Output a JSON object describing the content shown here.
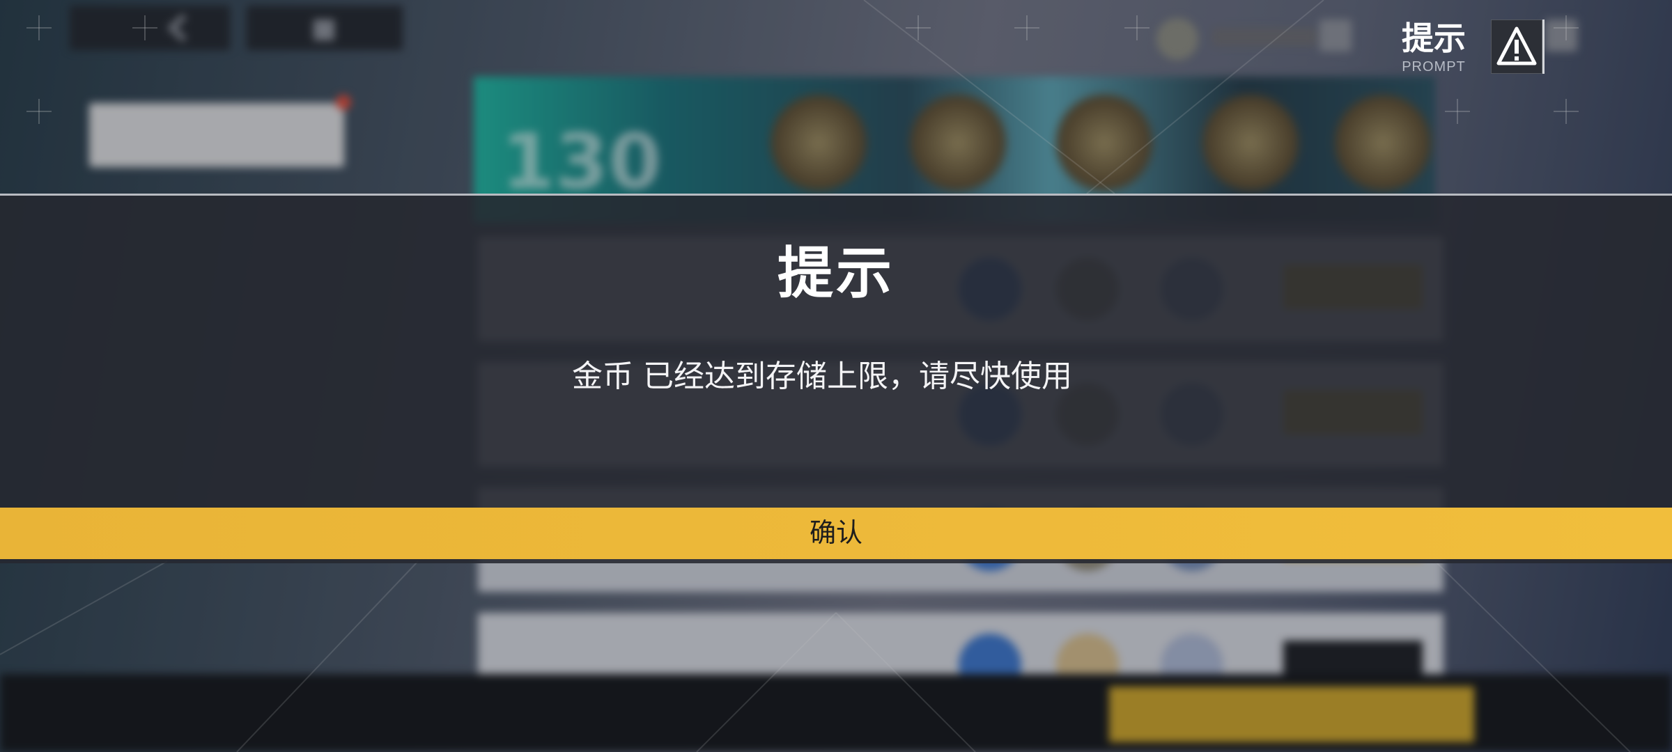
{
  "dialog": {
    "title": "提示",
    "message": "金币 已经达到存储上限，请尽快使用",
    "confirm_label": "确认"
  },
  "prompt_header": {
    "title": "提示",
    "subtitle": "PROMPT"
  },
  "background": {
    "banner_number": "130"
  },
  "colors": {
    "confirm": "#f0bd3c",
    "dialog_bg": "#262830",
    "text": "#ffffff"
  },
  "icons": {
    "back": "back-arrow-icon",
    "home": "home-icon",
    "warning": "warning-triangle-icon"
  }
}
